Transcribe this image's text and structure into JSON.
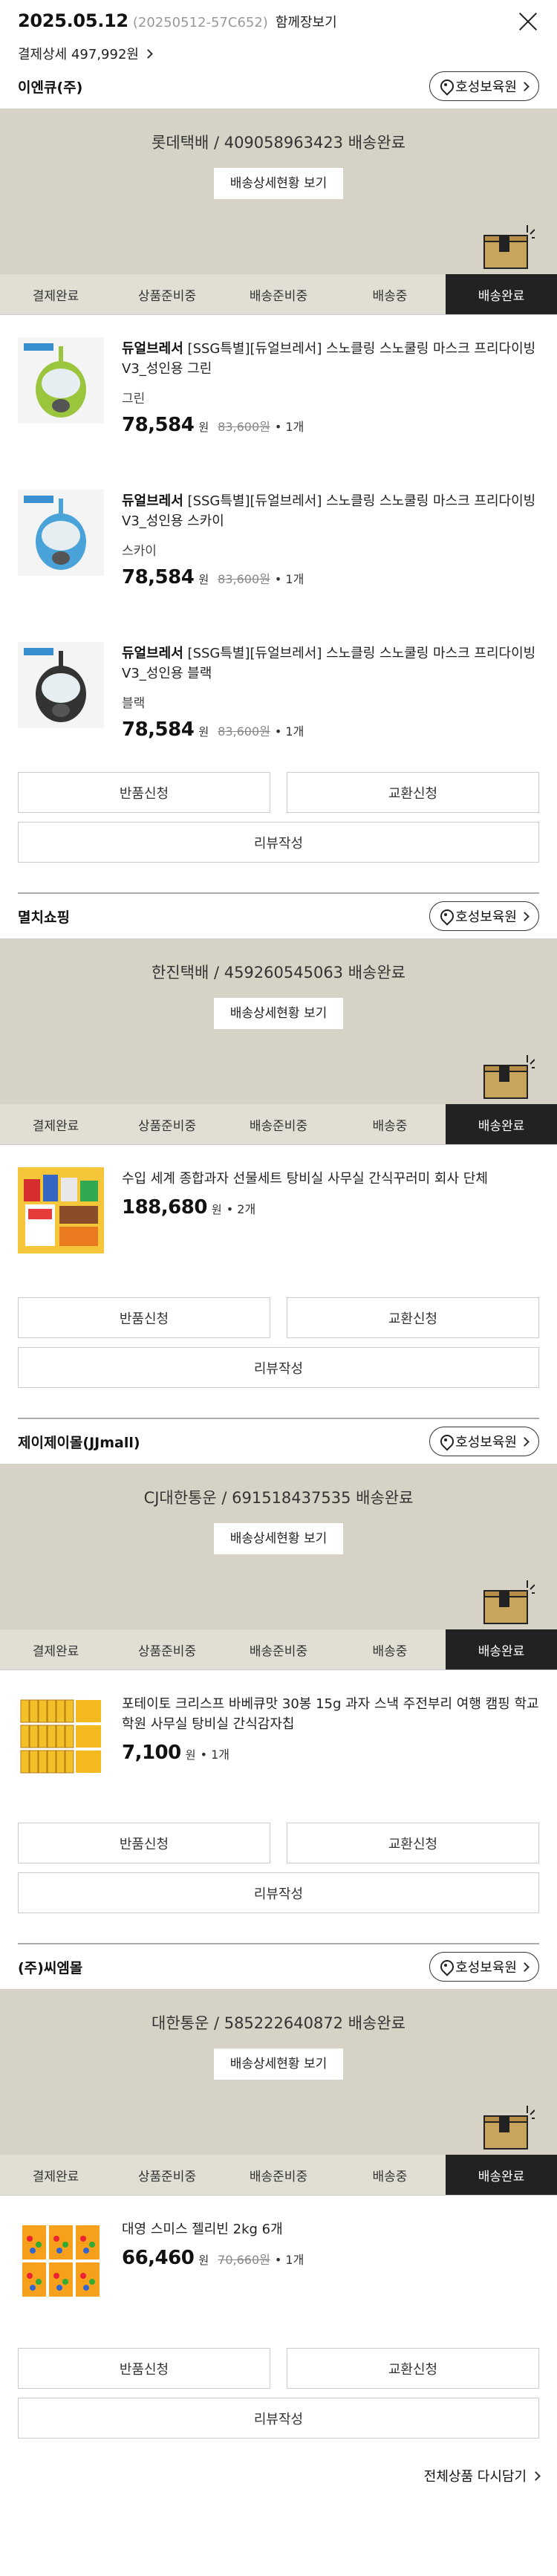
{
  "header": {
    "date": "2025.05.12",
    "order_no": "(20250512-57C652)",
    "combined_label": "함께장보기",
    "payment_detail": "결제상세 497,992원"
  },
  "steps": [
    "결제완료",
    "상품준비중",
    "배송준비중",
    "배송중",
    "배송완료"
  ],
  "sellers": [
    {
      "name": "이엔큐(주)",
      "store_label": "호성보육원",
      "shipping": "롯데택배 / 409058963423 배송완료",
      "detail_label": "배송상세현황 보기",
      "items": [
        {
          "brand": "듀얼브레서",
          "name": "[SSG특별][듀얼브레서] 스노클링 스노쿨링 마스크 프리다이빙V3_성인용 그린",
          "option": "그린",
          "price": "78,584",
          "won": "원",
          "orig": "83,600원",
          "qty": "• 1개",
          "mask_color": "#9bc53d"
        },
        {
          "brand": "듀얼브레서",
          "name": "[SSG특별][듀얼브레서] 스노클링 스노쿨링 마스크 프리다이빙V3_성인용 스카이",
          "option": "스카이",
          "price": "78,584",
          "won": "원",
          "orig": "83,600원",
          "qty": "• 1개",
          "mask_color": "#4aa3d8"
        },
        {
          "brand": "듀얼브레서",
          "name": "[SSG특별][듀얼브레서] 스노클링 스노쿨링 마스크 프리다이빙V3_성인용 블랙",
          "option": "블랙",
          "price": "78,584",
          "won": "원",
          "orig": "83,600원",
          "qty": "• 1개",
          "mask_color": "#333333"
        }
      ],
      "return_label": "반품신청",
      "exchange_label": "교환신청",
      "review_label": "리뷰작성"
    },
    {
      "name": "멸치쇼핑",
      "store_label": "호성보육원",
      "shipping": "한진택배 / 459260545063 배송완료",
      "detail_label": "배송상세현황 보기",
      "items": [
        {
          "brand": "",
          "name": "수입 세계 종합과자 선물세트 탕비실 사무실 간식꾸러미 회사 단체",
          "option": "",
          "price": "188,680",
          "won": "원",
          "orig": "",
          "qty": "• 2개",
          "mask_color": ""
        }
      ],
      "return_label": "반품신청",
      "exchange_label": "교환신청",
      "review_label": "리뷰작성"
    },
    {
      "name": "제이제이몰(JJmall)",
      "store_label": "호성보육원",
      "shipping": "CJ대한통운 / 691518437535 배송완료",
      "detail_label": "배송상세현황 보기",
      "items": [
        {
          "brand": "",
          "name": "포테이토 크리스프 바베큐맛 30봉 15g 과자 스낵 주전부리 여행 캠핑 학교 학원 사무실 탕비실 간식감자칩",
          "option": "",
          "price": "7,100",
          "won": "원",
          "orig": "",
          "qty": "• 1개",
          "mask_color": ""
        }
      ],
      "return_label": "반품신청",
      "exchange_label": "교환신청",
      "review_label": "리뷰작성"
    },
    {
      "name": "(주)씨엠몰",
      "store_label": "호성보육원",
      "shipping": "대한통운 / 585222640872 배송완료",
      "detail_label": "배송상세현황 보기",
      "items": [
        {
          "brand": "",
          "name": "대영 스미스 젤리빈 2kg 6개",
          "option": "",
          "price": "66,460",
          "won": "원",
          "orig": "70,660원",
          "qty": "• 1개",
          "mask_color": ""
        }
      ],
      "return_label": "반품신청",
      "exchange_label": "교환신청",
      "review_label": "리뷰작성"
    }
  ],
  "footer": {
    "buy_again": "전체상품 다시담기"
  }
}
